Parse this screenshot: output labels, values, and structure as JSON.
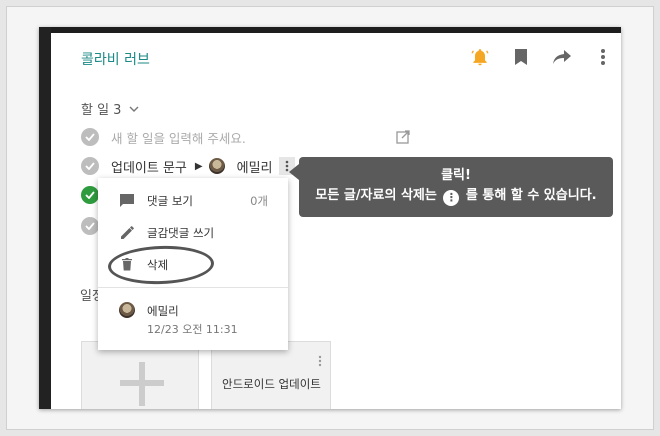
{
  "header": {
    "title": "콜라비 러브"
  },
  "todo": {
    "header_label": "할 일 3",
    "placeholder": "새 할 일을 입력해 주세요.",
    "task_text": "업데이트 문구",
    "task_user": "에밀리"
  },
  "tooltip": {
    "line1": "클릭!",
    "line2_before": "모든 글/자료의 삭제는",
    "line2_after": "를 통해 할 수 있습니다."
  },
  "menu": {
    "comments_label": "댓글 보기",
    "comments_count": "0개",
    "reply_label": "글감댓글 쓰기",
    "delete_label": "삭제",
    "author_name": "에밀리",
    "author_time": "12/23 오전 11:31"
  },
  "cards": {
    "section_label": "일정",
    "card2_label": "안드로이드 업데이트"
  },
  "colors": {
    "accent": "#1b8a86",
    "bell": "#f5a623",
    "check_done": "#2e9b3e",
    "tooltip_bg": "#5a5a5a"
  }
}
